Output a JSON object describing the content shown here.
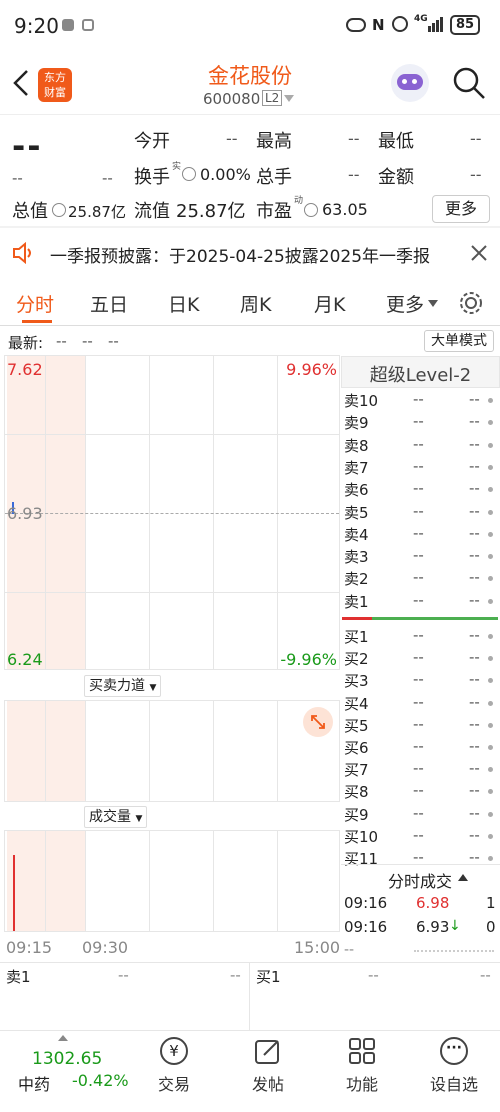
{
  "status_bar": {
    "time": "9:20",
    "battery": "85"
  },
  "header": {
    "stock_name": "金花股份",
    "stock_code": "600080",
    "level_badge": "L2",
    "logo_line1": "东方",
    "logo_line2": "财富"
  },
  "quote": {
    "price": "--",
    "change": "--",
    "change_pct": "--",
    "labels": {
      "open": "今开",
      "high": "最高",
      "low": "最低",
      "turnover": "换手",
      "turnover_sup": "实",
      "volume": "总手",
      "amount": "金额",
      "total_cap": "总值",
      "float_cap": "流值",
      "pe": "市盈",
      "pe_sup": "动"
    },
    "values": {
      "open": "--",
      "high": "--",
      "low": "--",
      "turnover": "0.00%",
      "volume": "--",
      "amount": "--",
      "total_cap": "25.87亿",
      "float_cap": "25.87亿",
      "pe": "63.05"
    },
    "more_label": "更多"
  },
  "notice": {
    "text": "一季报预披露：于2025-04-25披露2025年一季报"
  },
  "tabs": [
    "分时",
    "五日",
    "日K",
    "周K",
    "月K",
    "更多"
  ],
  "chart": {
    "latest_label": "最新:",
    "latest_values": [
      "--",
      "--",
      "--"
    ],
    "big_order_mode": "大单模式",
    "y_top": "7.62",
    "y_mid": "6.93",
    "y_bottom": "6.24",
    "pct_top": "9.96%",
    "pct_bottom": "-9.96%",
    "indicator1": "买卖力道",
    "indicator2": "成交量",
    "time_start": "09:15",
    "time_mid": "09:30",
    "time_end": "15:00"
  },
  "orderbook": {
    "title": "超级Level-2",
    "sells": [
      "卖10",
      "卖9",
      "卖8",
      "卖7",
      "卖6",
      "卖5",
      "卖4",
      "卖3",
      "卖2",
      "卖1"
    ],
    "buys": [
      "买1",
      "买2",
      "买3",
      "买4",
      "买5",
      "买6",
      "买7",
      "买8",
      "买9",
      "买10",
      "买11"
    ],
    "placeholder": "--"
  },
  "trades": {
    "title": "分时成交",
    "rows": [
      {
        "time": "09:16",
        "price": "6.98",
        "vol": "1"
      },
      {
        "time": "09:16",
        "price": "6.93",
        "vol": "0"
      }
    ],
    "extra_placeholder": "--"
  },
  "bottom_quote": {
    "sell_label": "卖1",
    "buy_label": "买1",
    "val": "--"
  },
  "index": {
    "value": "1302.65",
    "name": "中药",
    "change": "-0.42%"
  },
  "nav": [
    "交易",
    "发帖",
    "功能",
    "设自选"
  ]
}
